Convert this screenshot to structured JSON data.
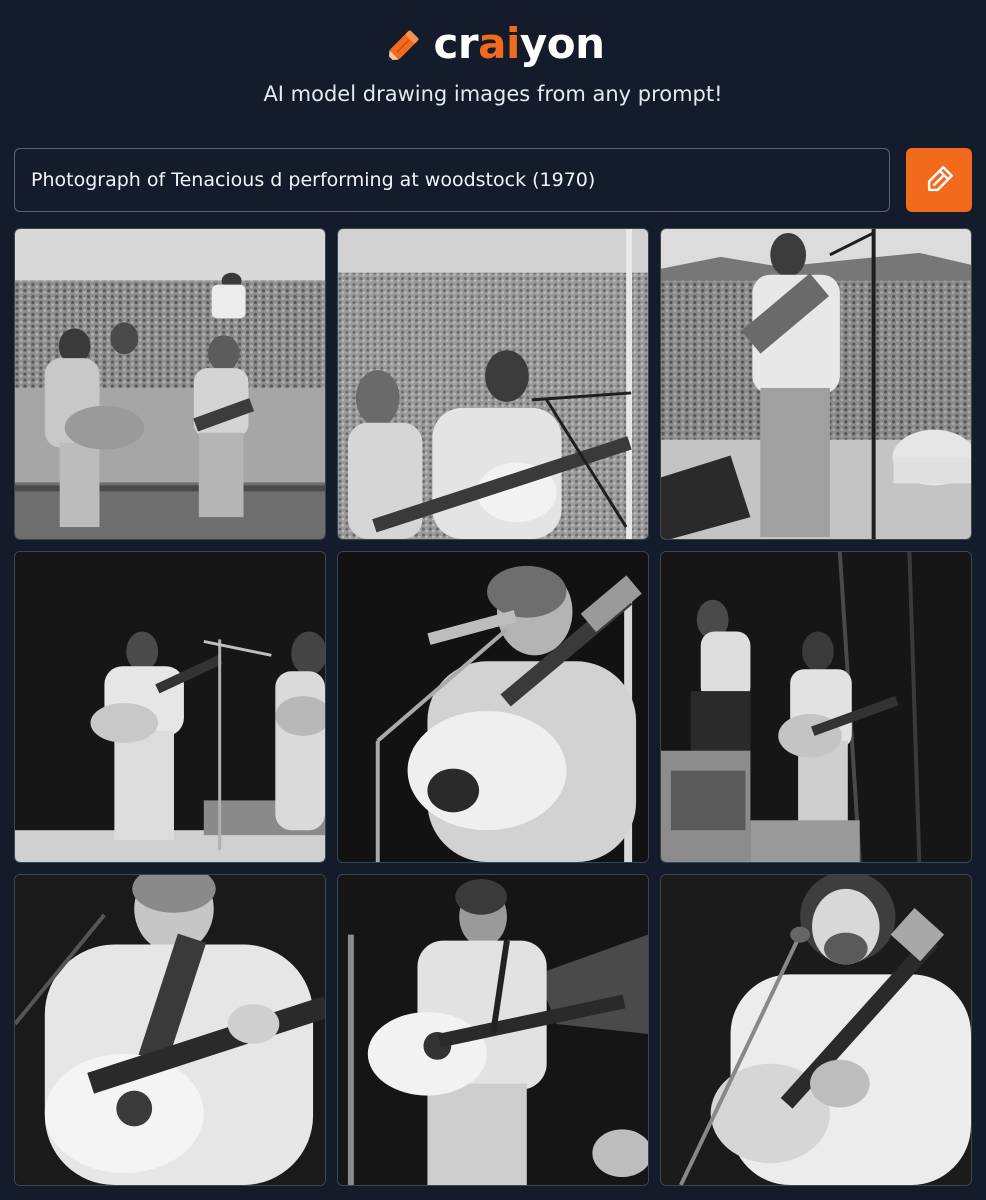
{
  "app": {
    "logo_prefix": "cr",
    "logo_ai": "ai",
    "logo_suffix": "yon",
    "tagline": "AI model drawing images from any prompt!",
    "accent_color": "#f26b1d",
    "background_color": "#141b2b"
  },
  "prompt": {
    "value": "Photograph of Tenacious d performing at woodstock (1970)"
  },
  "draw_button": {
    "icon": "pencil-icon"
  },
  "results": {
    "images": [
      {
        "index": 1,
        "style": "outdoor-crowd-duo"
      },
      {
        "index": 2,
        "style": "outdoor-crowd-closeup"
      },
      {
        "index": 3,
        "style": "outdoor-stage-standing"
      },
      {
        "index": 4,
        "style": "dark-stage-duo"
      },
      {
        "index": 5,
        "style": "dark-closeup-mic"
      },
      {
        "index": 6,
        "style": "dark-stage-duo-wide"
      },
      {
        "index": 7,
        "style": "dark-closeup-guitar"
      },
      {
        "index": 8,
        "style": "dark-midshot-guitar"
      },
      {
        "index": 9,
        "style": "dark-closeup-singing"
      }
    ]
  }
}
